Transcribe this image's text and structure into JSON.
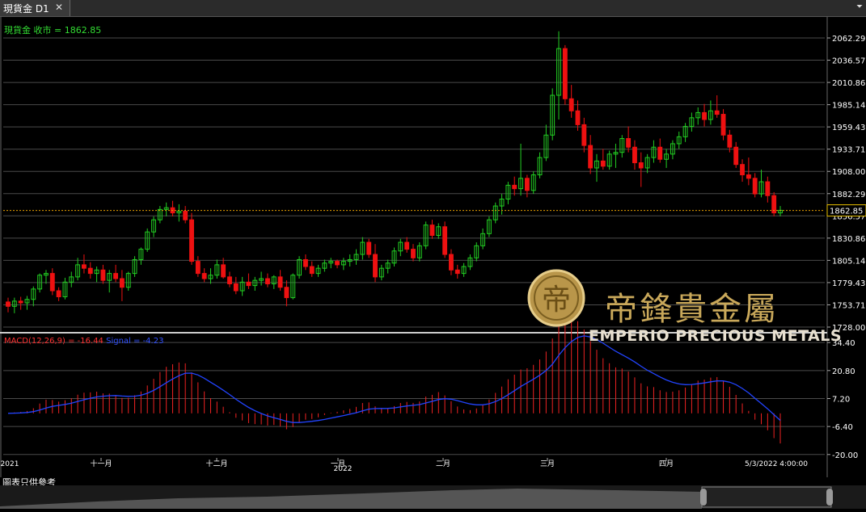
{
  "window": {
    "tab_title": "現貨金 D1",
    "close_glyph": "✕",
    "menu_glyph": "⏷"
  },
  "price_panel": {
    "label": "現貨金 收市 = 1862.85",
    "current_price": "1862.85"
  },
  "macd_panel": {
    "macd_label": "MACD(12,26,9) = -16.44",
    "signal_label": "Signal = -4.23"
  },
  "footer": {
    "note": "圖表只供參考"
  },
  "logo": {
    "name_cn": "帝鋒貴金屬",
    "name_en": "EMPERIO PRECIOUS METALS",
    "emblem_glyph": "帝"
  },
  "colors": {
    "bull": "#22cc22",
    "bear": "#ee1111",
    "macd_hist": "#ee2222",
    "signal": "#2244ff",
    "grid": "#4a4a4a",
    "axis_text": "#ffffff",
    "current_line": "#e8a000"
  },
  "chart_data": [
    {
      "type": "candlestick",
      "title": "現貨金 D1",
      "y_ticks": [
        "2062.29",
        "2036.57",
        "2010.86",
        "1985.14",
        "1959.43",
        "1933.71",
        "1908.00",
        "1882.29",
        "1856.57",
        "1830.86",
        "1805.14",
        "1779.43",
        "1753.71",
        "1728.00"
      ],
      "ylim": [
        1728.0,
        2062.29
      ],
      "x_labels": [
        "2021",
        "十一月",
        "十二月",
        "一月",
        "2022",
        "二月",
        "三月",
        "四月",
        "5/3/2022 4:00:00"
      ],
      "current_price": 1862.85,
      "grid": true,
      "ohlc": [
        [
          1757,
          1762,
          1745,
          1752
        ],
        [
          1752,
          1762,
          1744,
          1758
        ],
        [
          1758,
          1763,
          1748,
          1756
        ],
        [
          1756,
          1764,
          1748,
          1760
        ],
        [
          1760,
          1775,
          1752,
          1772
        ],
        [
          1772,
          1790,
          1768,
          1788
        ],
        [
          1788,
          1794,
          1778,
          1790
        ],
        [
          1790,
          1796,
          1765,
          1770
        ],
        [
          1770,
          1774,
          1758,
          1763
        ],
        [
          1763,
          1785,
          1760,
          1780
        ],
        [
          1780,
          1792,
          1774,
          1786
        ],
        [
          1786,
          1808,
          1782,
          1800
        ],
        [
          1800,
          1812,
          1790,
          1796
        ],
        [
          1796,
          1803,
          1784,
          1790
        ],
        [
          1790,
          1798,
          1780,
          1794
        ],
        [
          1794,
          1800,
          1778,
          1782
        ],
        [
          1782,
          1794,
          1768,
          1790
        ],
        [
          1790,
          1800,
          1780,
          1784
        ],
        [
          1784,
          1794,
          1758,
          1774
        ],
        [
          1774,
          1792,
          1770,
          1790
        ],
        [
          1790,
          1810,
          1786,
          1806
        ],
        [
          1806,
          1820,
          1800,
          1818
        ],
        [
          1818,
          1842,
          1815,
          1838
        ],
        [
          1838,
          1856,
          1832,
          1852
        ],
        [
          1852,
          1868,
          1848,
          1864
        ],
        [
          1864,
          1872,
          1856,
          1866
        ],
        [
          1866,
          1874,
          1856,
          1860
        ],
        [
          1860,
          1870,
          1850,
          1862
        ],
        [
          1862,
          1868,
          1848,
          1852
        ],
        [
          1852,
          1860,
          1800,
          1804
        ],
        [
          1804,
          1810,
          1786,
          1790
        ],
        [
          1790,
          1796,
          1780,
          1784
        ],
        [
          1784,
          1796,
          1778,
          1788
        ],
        [
          1788,
          1806,
          1784,
          1800
        ],
        [
          1800,
          1808,
          1784,
          1786
        ],
        [
          1786,
          1792,
          1774,
          1778
        ],
        [
          1778,
          1786,
          1766,
          1770
        ],
        [
          1770,
          1786,
          1764,
          1780
        ],
        [
          1780,
          1790,
          1772,
          1776
        ],
        [
          1776,
          1786,
          1770,
          1782
        ],
        [
          1782,
          1792,
          1776,
          1784
        ],
        [
          1784,
          1790,
          1774,
          1778
        ],
        [
          1778,
          1788,
          1772,
          1786
        ],
        [
          1786,
          1794,
          1770,
          1774
        ],
        [
          1774,
          1782,
          1752,
          1762
        ],
        [
          1762,
          1790,
          1760,
          1788
        ],
        [
          1788,
          1810,
          1784,
          1806
        ],
        [
          1806,
          1812,
          1794,
          1798
        ],
        [
          1798,
          1804,
          1786,
          1790
        ],
        [
          1790,
          1800,
          1786,
          1796
        ],
        [
          1796,
          1806,
          1792,
          1802
        ],
        [
          1802,
          1808,
          1796,
          1804
        ],
        [
          1804,
          1806,
          1796,
          1800
        ],
        [
          1800,
          1808,
          1794,
          1804
        ],
        [
          1804,
          1812,
          1798,
          1806
        ],
        [
          1806,
          1818,
          1800,
          1812
        ],
        [
          1812,
          1832,
          1806,
          1826
        ],
        [
          1826,
          1830,
          1808,
          1812
        ],
        [
          1812,
          1824,
          1780,
          1786
        ],
        [
          1786,
          1800,
          1782,
          1796
        ],
        [
          1796,
          1806,
          1790,
          1802
        ],
        [
          1802,
          1820,
          1798,
          1816
        ],
        [
          1816,
          1830,
          1810,
          1826
        ],
        [
          1826,
          1832,
          1814,
          1818
        ],
        [
          1818,
          1824,
          1804,
          1808
        ],
        [
          1808,
          1826,
          1804,
          1822
        ],
        [
          1822,
          1850,
          1818,
          1846
        ],
        [
          1846,
          1852,
          1830,
          1834
        ],
        [
          1834,
          1848,
          1830,
          1844
        ],
        [
          1844,
          1850,
          1808,
          1812
        ],
        [
          1812,
          1818,
          1788,
          1794
        ],
        [
          1794,
          1800,
          1784,
          1790
        ],
        [
          1790,
          1802,
          1786,
          1798
        ],
        [
          1798,
          1812,
          1794,
          1808
        ],
        [
          1808,
          1826,
          1804,
          1822
        ],
        [
          1822,
          1842,
          1818,
          1836
        ],
        [
          1836,
          1856,
          1832,
          1852
        ],
        [
          1852,
          1872,
          1848,
          1868
        ],
        [
          1868,
          1882,
          1858,
          1876
        ],
        [
          1876,
          1896,
          1870,
          1892
        ],
        [
          1892,
          1902,
          1880,
          1888
        ],
        [
          1888,
          1940,
          1880,
          1900
        ],
        [
          1900,
          1904,
          1878,
          1886
        ],
        [
          1886,
          1908,
          1882,
          1904
        ],
        [
          1904,
          1930,
          1900,
          1924
        ],
        [
          1924,
          1962,
          1920,
          1950
        ],
        [
          1950,
          2004,
          1944,
          1996
        ],
        [
          1996,
          2070,
          1968,
          2050
        ],
        [
          2050,
          2054,
          1985,
          1992
        ],
        [
          1992,
          2008,
          1970,
          1978
        ],
        [
          1978,
          1990,
          1955,
          1962
        ],
        [
          1962,
          1970,
          1930,
          1938
        ],
        [
          1938,
          1950,
          1905,
          1912
        ],
        [
          1912,
          1928,
          1896,
          1920
        ],
        [
          1920,
          1934,
          1910,
          1914
        ],
        [
          1914,
          1932,
          1910,
          1928
        ],
        [
          1928,
          1940,
          1912,
          1930
        ],
        [
          1930,
          1950,
          1924,
          1946
        ],
        [
          1946,
          1960,
          1930,
          1936
        ],
        [
          1936,
          1944,
          1910,
          1918
        ],
        [
          1918,
          1930,
          1890,
          1912
        ],
        [
          1912,
          1928,
          1906,
          1924
        ],
        [
          1924,
          1944,
          1918,
          1936
        ],
        [
          1936,
          1946,
          1918,
          1922
        ],
        [
          1922,
          1934,
          1912,
          1928
        ],
        [
          1928,
          1944,
          1922,
          1940
        ],
        [
          1940,
          1954,
          1934,
          1948
        ],
        [
          1948,
          1964,
          1942,
          1960
        ],
        [
          1960,
          1976,
          1954,
          1970
        ],
        [
          1970,
          1982,
          1962,
          1976
        ],
        [
          1976,
          1986,
          1960,
          1968
        ],
        [
          1968,
          1990,
          1962,
          1978
        ],
        [
          1978,
          1996,
          1970,
          1974
        ],
        [
          1974,
          1980,
          1944,
          1950
        ],
        [
          1950,
          1956,
          1930,
          1936
        ],
        [
          1936,
          1942,
          1912,
          1916
        ],
        [
          1916,
          1922,
          1896,
          1904
        ],
        [
          1904,
          1924,
          1892,
          1900
        ],
        [
          1900,
          1906,
          1878,
          1882
        ],
        [
          1882,
          1910,
          1878,
          1896
        ],
        [
          1896,
          1902,
          1872,
          1880
        ],
        [
          1880,
          1884,
          1856,
          1860
        ],
        [
          1860,
          1868,
          1856,
          1863
        ]
      ]
    },
    {
      "type": "bar+line",
      "title": "MACD(12,26,9)",
      "y_ticks": [
        "34.40",
        "20.80",
        "7.20",
        "-6.40",
        "-20.00"
      ],
      "ylim": [
        -24.0,
        38.0
      ],
      "macd_value": -16.44,
      "signal_value": -4.23
    }
  ]
}
